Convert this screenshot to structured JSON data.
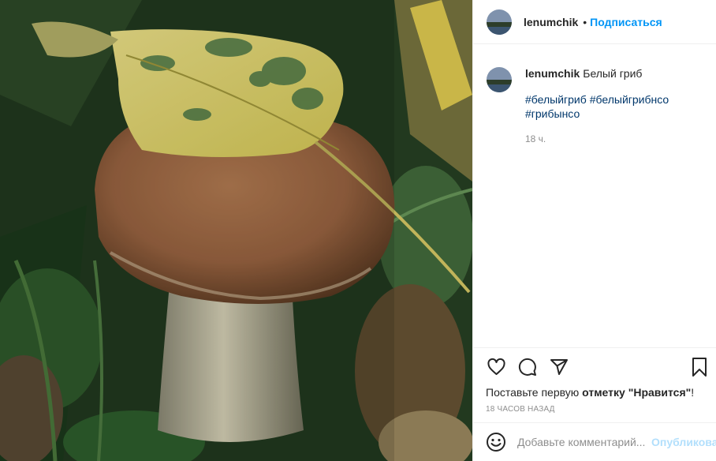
{
  "post": {
    "username": "lenumchik",
    "follow_label": "Подписаться",
    "separator": "•",
    "caption": "Белый гриб",
    "hashtags": [
      "#белыйгриб",
      "#белыйгрибнсо",
      "#грибынсо"
    ],
    "time_ago": "18 ч.",
    "likes_prefix": "Поставьте первую ",
    "likes_bold": "отметку \"Нравится\"",
    "likes_suffix": "!",
    "posted_ago": "18 часов назад"
  },
  "comment": {
    "placeholder": "Добавьте комментарий...",
    "publish_label": "Опубликовать"
  },
  "icons": {
    "like": "heart-icon",
    "comment": "comment-icon",
    "share": "paper-plane-icon",
    "save": "bookmark-icon",
    "emoji": "smiley-icon"
  },
  "colors": {
    "accent": "#0095f6",
    "hashtag": "#00376b",
    "muted": "#8e8e8e",
    "publish_disabled": "#b2dffc"
  }
}
